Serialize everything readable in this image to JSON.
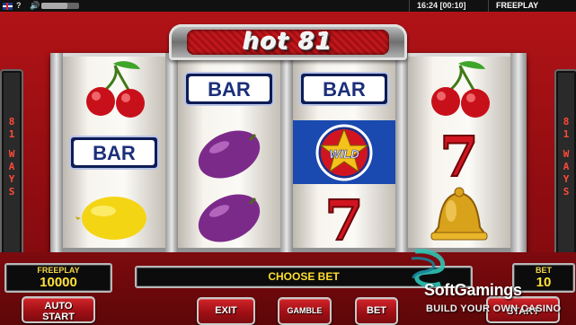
{
  "topbar": {
    "language_icon": "uk-flag-icon",
    "help_icon_glyph": "?",
    "sound_icon_glyph": "🔊",
    "clock": "16:24 [00:10]",
    "mode": "FREEPLAY"
  },
  "game": {
    "logo": "hot 81",
    "ways_label_left": "81 WAYS",
    "ways_label_right": "81 WAYS"
  },
  "reels": [
    [
      "cherry",
      "bar",
      "lemon"
    ],
    [
      "bar",
      "plum",
      "plum"
    ],
    [
      "bar",
      "wild",
      "seven"
    ],
    [
      "cherry",
      "seven",
      "bell"
    ]
  ],
  "symbols": {
    "bar_text": "BAR",
    "wild_text": "WILD"
  },
  "panel": {
    "freeplay_label": "FREEPLAY",
    "freeplay_value": "10000",
    "message": "CHOOSE BET",
    "bet_label": "BET",
    "bet_value": "10"
  },
  "buttons": {
    "auto_start": "AUTO\nSTART",
    "exit": "EXIT",
    "gamble": "GAMBLE",
    "bet": "BET",
    "start": "START"
  },
  "watermark": {
    "brand": "SoftGamings",
    "tagline": "BUILD YOUR OWN CASINO"
  },
  "colors": {
    "cabinet_red": "#b11317",
    "display_text": "#ffe23a",
    "ways_text": "#ff4a3a",
    "wild_highlight": "#1a4ab0"
  }
}
